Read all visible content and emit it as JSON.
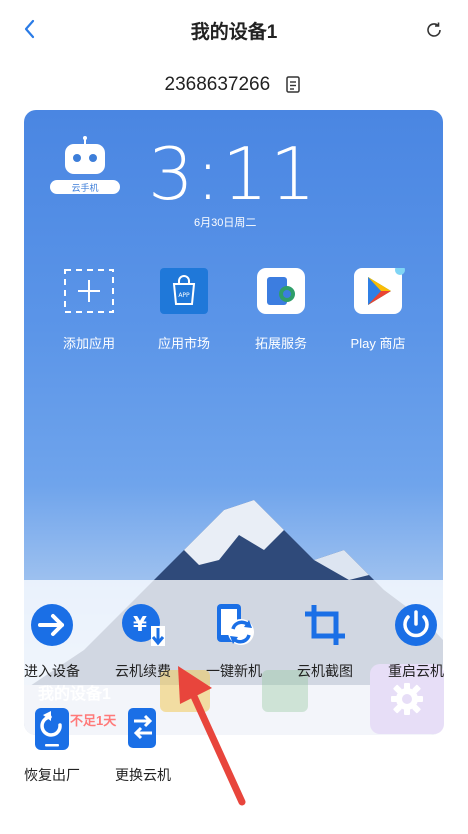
{
  "header": {
    "title": "我的设备1",
    "device_id": "2368637266"
  },
  "screen": {
    "time": "3:11",
    "date": "6月30日周二",
    "logo_text": "云手机",
    "apps": [
      {
        "label": "添加应用",
        "icon": "add-app-icon"
      },
      {
        "label": "应用市场",
        "icon": "app-market-icon",
        "badge": "APP"
      },
      {
        "label": "拓展服务",
        "icon": "extension-service-icon"
      },
      {
        "label": "Play 商店",
        "icon": "play-store-icon"
      }
    ]
  },
  "actions": [
    {
      "label": "进入设备",
      "icon": "enter-device-icon"
    },
    {
      "label": "云机续费",
      "icon": "renew-icon"
    },
    {
      "label": "一键新机",
      "icon": "new-device-icon"
    },
    {
      "label": "云机截图",
      "icon": "screenshot-crop-icon"
    },
    {
      "label": "重启云机",
      "icon": "power-icon"
    },
    {
      "label": "恢复出厂",
      "icon": "factory-reset-icon"
    },
    {
      "label": "更换云机",
      "icon": "replace-device-icon"
    }
  ],
  "background_card": {
    "device_name": "我的设备1",
    "expiry_text": "不足1天"
  },
  "colors": {
    "accent": "#1a6fe6",
    "arrow": "#e8453c"
  }
}
